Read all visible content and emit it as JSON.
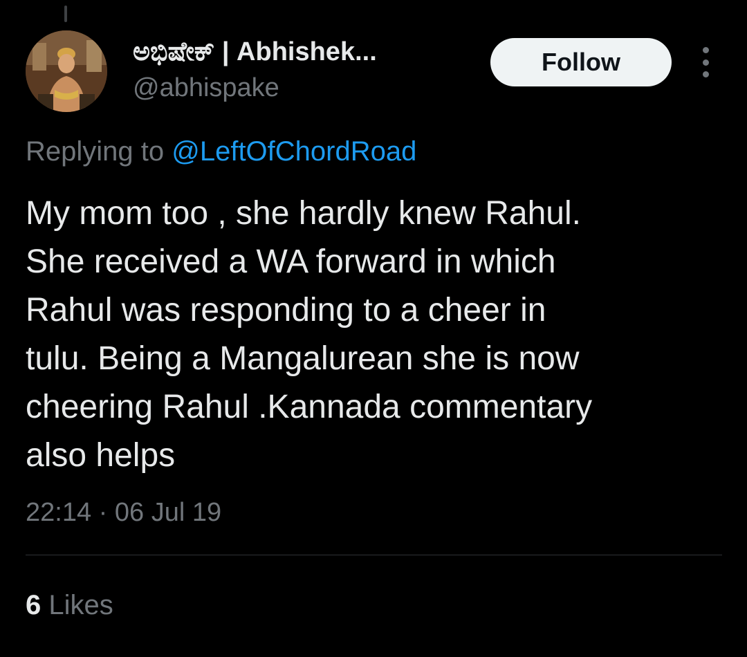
{
  "author": {
    "display_name": "ಅಭಿಷೇಕ್ | Abhishek...",
    "handle": "@abhispake"
  },
  "follow_label": "Follow",
  "reply_context": {
    "prefix": "Replying to ",
    "mention": "@LeftOfChordRoad"
  },
  "tweet": {
    "text": "My mom too , she hardly knew Rahul.\nShe received a WA forward in which\nRahul was responding to a cheer in\ntulu. Being a Mangalurean she is now\ncheering Rahul .Kannada commentary\nalso helps",
    "timestamp": "22:14 · 06 Jul 19"
  },
  "stats": {
    "likes_count": "6",
    "likes_label": " Likes"
  },
  "icons": {
    "more": "more-vertical-icon",
    "avatar": "profile-avatar-image"
  },
  "colors": {
    "background": "#000000",
    "primary_text": "#e7e9ea",
    "secondary_text": "#71767b",
    "link": "#1d9bf0",
    "follow_bg": "#eff3f4",
    "divider": "#2f3336"
  }
}
